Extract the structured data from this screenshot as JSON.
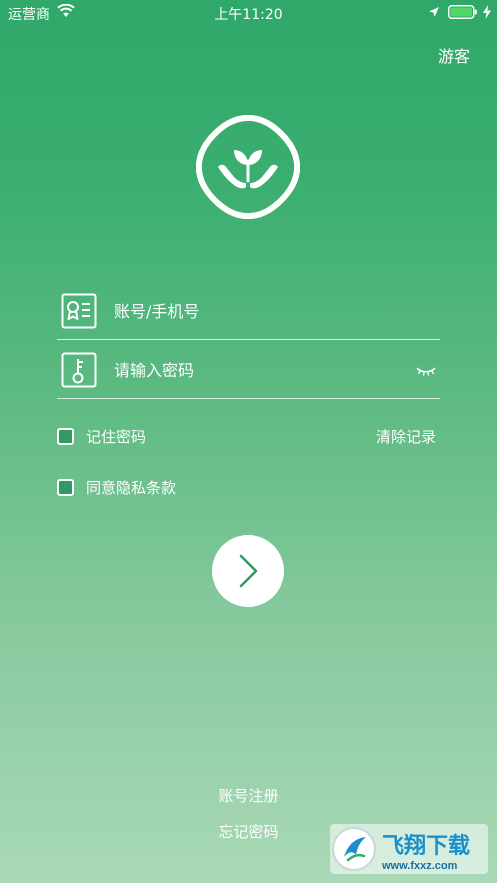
{
  "status_bar": {
    "carrier": "运营商",
    "time": "上午11:20",
    "wifi_icon": "wifi-icon",
    "location_icon": "location-arrow-icon",
    "battery_icon": "battery-full-icon",
    "charging_icon": "charging-bolt-icon"
  },
  "header": {
    "guest_label": "游客"
  },
  "logo": {
    "icon": "sprout-in-hands-logo"
  },
  "form": {
    "account": {
      "placeholder": "账号/手机号",
      "value": "",
      "icon": "id-card-icon"
    },
    "password": {
      "placeholder": "请输入密码",
      "value": "",
      "icon": "key-icon",
      "toggle_icon": "eye-closed-icon"
    },
    "remember_label": "记住密码",
    "clear_label": "清除记录",
    "privacy_label": "同意隐私条款",
    "submit_icon": "chevron-right-icon"
  },
  "footer": {
    "register_label": "账号注册",
    "forgot_label": "忘记密码"
  },
  "watermark": {
    "text": "飞翔下载",
    "url": "www.fxxz.com"
  },
  "colors": {
    "gradient_top": "#2fa86a",
    "gradient_bottom": "#a9d9b6",
    "checkbox_fill": "#2f9a62",
    "accent": "#2e9b63",
    "battery": "#4cd964"
  }
}
